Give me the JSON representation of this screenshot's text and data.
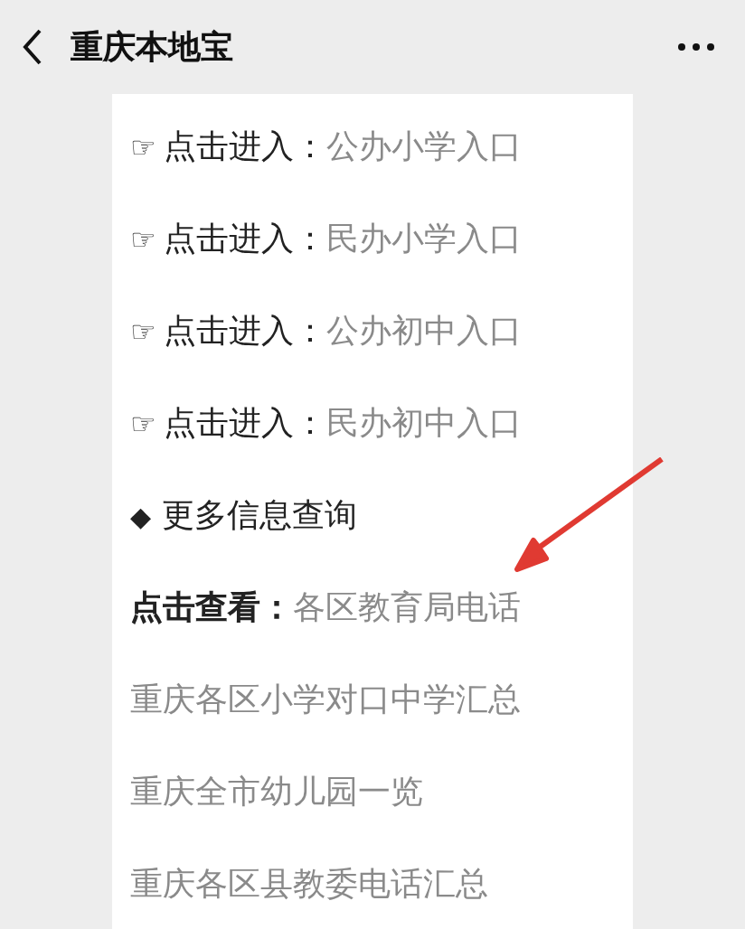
{
  "header": {
    "title": "重庆本地宝"
  },
  "items": [
    {
      "kind": "entry",
      "icon": "☞",
      "label": "点击进入：",
      "link": "公办小学入口"
    },
    {
      "kind": "entry",
      "icon": "☞",
      "label": "点击进入：",
      "link": "民办小学入口"
    },
    {
      "kind": "entry",
      "icon": "☞",
      "label": "点击进入：",
      "link": "公办初中入口"
    },
    {
      "kind": "entry",
      "icon": "☞",
      "label": "点击进入：",
      "link": "民办初中入口"
    },
    {
      "kind": "heading",
      "icon": "◆",
      "text": "更多信息查询"
    },
    {
      "kind": "entry",
      "label": "点击查看：",
      "link": "各区教育局电话"
    },
    {
      "kind": "link",
      "text": "重庆各区小学对口中学汇总"
    },
    {
      "kind": "link",
      "text": "重庆全市幼儿园一览"
    },
    {
      "kind": "link",
      "text": "重庆各区县教委电话汇总"
    }
  ]
}
